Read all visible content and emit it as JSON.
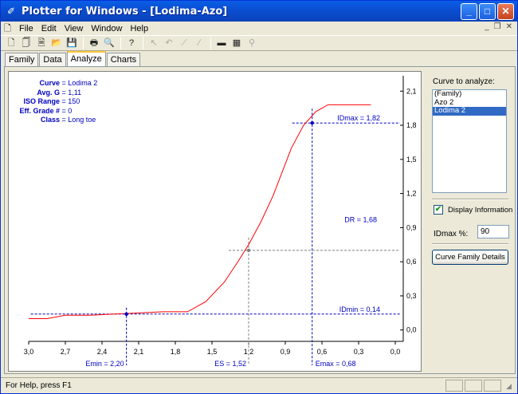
{
  "window": {
    "title": "Plotter for Windows - [Lodima-Azo]",
    "minimize": "_",
    "maximize": "□",
    "close": "✕"
  },
  "menu": {
    "items": [
      "File",
      "Edit",
      "View",
      "Window",
      "Help"
    ],
    "mdi_minimize": "_",
    "mdi_restore": "❐",
    "mdi_close": "✕"
  },
  "toolbar": {
    "tools": [
      {
        "name": "new-icon",
        "glyph": "🗋",
        "enabled": true
      },
      {
        "name": "copy-doc-icon",
        "glyph": "🗍",
        "enabled": true
      },
      {
        "name": "add-doc-icon",
        "glyph": "🗎",
        "enabled": true
      },
      {
        "name": "open-folder-icon",
        "glyph": "📂",
        "enabled": true
      },
      {
        "name": "save-icon",
        "glyph": "💾",
        "enabled": true
      },
      {
        "sep": true
      },
      {
        "name": "print-icon",
        "glyph": "🖶",
        "enabled": true
      },
      {
        "name": "print-preview-icon",
        "glyph": "🔍",
        "enabled": true
      },
      {
        "sep": true
      },
      {
        "name": "help-icon",
        "glyph": "?",
        "enabled": true
      },
      {
        "sep": true
      },
      {
        "name": "pointer-icon",
        "glyph": "↖",
        "enabled": false
      },
      {
        "name": "undo-icon",
        "glyph": "↶",
        "enabled": false
      },
      {
        "name": "add-point-icon",
        "glyph": "⟋",
        "enabled": false
      },
      {
        "name": "draw-curve-icon",
        "glyph": "∕",
        "enabled": false
      },
      {
        "sep": true
      },
      {
        "name": "color-icon",
        "glyph": "▬",
        "enabled": true
      },
      {
        "name": "grid-icon",
        "glyph": "▦",
        "enabled": true
      },
      {
        "name": "zoom-icon",
        "glyph": "⚲",
        "enabled": false
      }
    ]
  },
  "tabs": [
    {
      "label": "Family",
      "active": false
    },
    {
      "label": "Data",
      "active": false
    },
    {
      "label": "Analyze",
      "active": true
    },
    {
      "label": "Charts",
      "active": false
    }
  ],
  "info": [
    {
      "key": "Curve",
      "value": "Lodima 2"
    },
    {
      "key": "Avg. G",
      "value": "1,11"
    },
    {
      "key": "ISO Range",
      "value": "150"
    },
    {
      "key": "Eff. Grade #",
      "value": "0"
    },
    {
      "key": "Class",
      "value": "Long toe"
    }
  ],
  "chart_data": {
    "type": "line",
    "x_ticks": [
      "3,0",
      "2,7",
      "2,4",
      "2,1",
      "1,8",
      "1,5",
      "1,2",
      "0,9",
      "0,6",
      "0,3",
      "0,0"
    ],
    "y_ticks": [
      "0,0",
      "0,3",
      "0,6",
      "0,9",
      "1,2",
      "1,5",
      "1,8",
      "2,1"
    ],
    "xlim": [
      3.0,
      0.0
    ],
    "ylim": [
      -0.1,
      2.2
    ],
    "series": [
      {
        "color": "#ff0000",
        "x": [
          3.0,
          2.85,
          2.7,
          2.5,
          2.3,
          2.1,
          1.9,
          1.7,
          1.55,
          1.4,
          1.3,
          1.2,
          1.1,
          1.0,
          0.85,
          0.75,
          0.65,
          0.55,
          0.4,
          0.2
        ],
        "y": [
          0.1,
          0.1,
          0.13,
          0.13,
          0.14,
          0.15,
          0.16,
          0.16,
          0.25,
          0.42,
          0.58,
          0.75,
          0.95,
          1.18,
          1.6,
          1.8,
          1.92,
          1.98,
          1.98,
          1.98
        ]
      }
    ],
    "annotations": {
      "idmax": "IDmax = 1,82",
      "idmin": "IDmin = 0,14",
      "dr": "DR = 1,68",
      "emin": "Emin = 2,20",
      "es": "ES = 1,52",
      "emax": "Emax = 0,68"
    },
    "markers": [
      {
        "x": 2.2,
        "y": 0.14,
        "color": "#0000c0"
      },
      {
        "x": 0.68,
        "y": 1.82,
        "color": "#0000c0"
      },
      {
        "x": 1.2,
        "y": 0.7,
        "color": "#808080"
      }
    ],
    "guides": {
      "idmax_y": 1.82,
      "idmin_y": 0.14,
      "mid_y": 0.7,
      "emin_x": 2.2,
      "es_x": 1.2,
      "emax_x": 0.68
    }
  },
  "right_panel": {
    "curve_label": "Curve to analyze:",
    "curves": [
      {
        "label": "(Family)",
        "selected": false
      },
      {
        "label": "Azo 2",
        "selected": false
      },
      {
        "label": "Lodima 2",
        "selected": true
      }
    ],
    "display_info_label": "Display Information",
    "display_info_checked": "✔",
    "idmax_label": "IDmax %:",
    "idmax_value": "90",
    "details_button": "Curve Family Details"
  },
  "status": {
    "text": "For Help, press F1"
  }
}
